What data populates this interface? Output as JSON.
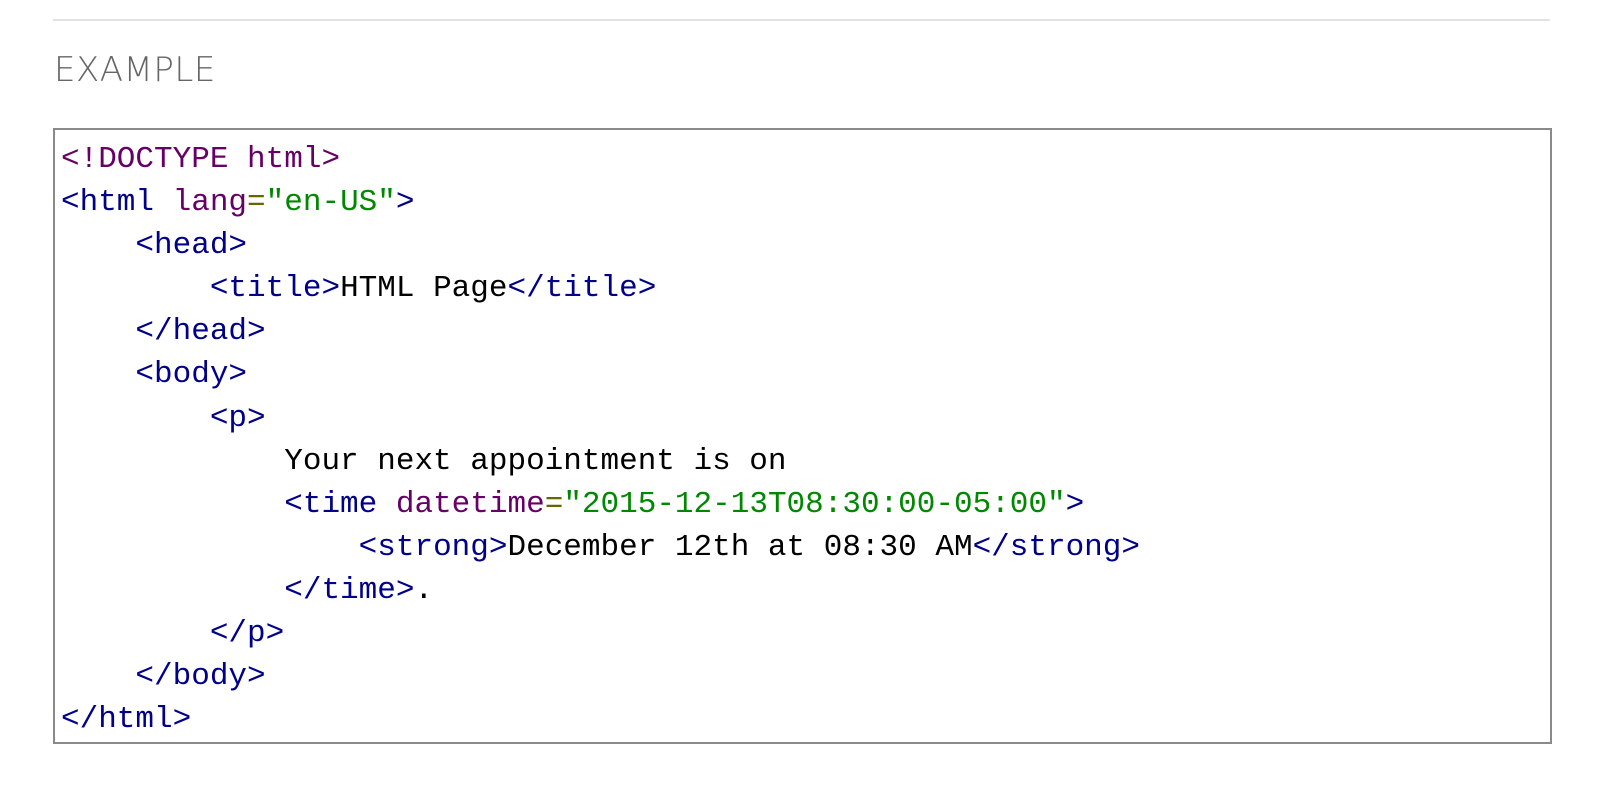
{
  "section": {
    "heading": "EXAMPLE"
  },
  "code": {
    "lines": [
      [
        [
          "dec",
          "<!DOCTYPE html>"
        ]
      ],
      [
        [
          "tag",
          "<html"
        ],
        [
          "pln",
          " "
        ],
        [
          "atn",
          "lang"
        ],
        [
          "pun",
          "="
        ],
        [
          "str",
          "\"en-US\""
        ],
        [
          "tag",
          ">"
        ]
      ],
      [
        [
          "pln",
          "    "
        ],
        [
          "tag",
          "<head>"
        ]
      ],
      [
        [
          "pln",
          "        "
        ],
        [
          "tag",
          "<title>"
        ],
        [
          "pln",
          "HTML Page"
        ],
        [
          "tag",
          "</title>"
        ]
      ],
      [
        [
          "pln",
          "    "
        ],
        [
          "tag",
          "</head>"
        ]
      ],
      [
        [
          "pln",
          "    "
        ],
        [
          "tag",
          "<body>"
        ]
      ],
      [
        [
          "pln",
          "        "
        ],
        [
          "tag",
          "<p>"
        ]
      ],
      [
        [
          "pln",
          "            Your next appointment is on"
        ]
      ],
      [
        [
          "pln",
          "            "
        ],
        [
          "tag",
          "<time"
        ],
        [
          "pln",
          " "
        ],
        [
          "atn",
          "datetime"
        ],
        [
          "pun",
          "="
        ],
        [
          "str",
          "\"2015-12-13T08:30:00-05:00\""
        ],
        [
          "tag",
          ">"
        ]
      ],
      [
        [
          "pln",
          "                "
        ],
        [
          "tag",
          "<strong>"
        ],
        [
          "pln",
          "December 12th at 08:30 AM"
        ],
        [
          "tag",
          "</strong>"
        ]
      ],
      [
        [
          "pln",
          "            "
        ],
        [
          "tag",
          "</time>"
        ],
        [
          "pln",
          "."
        ]
      ],
      [
        [
          "pln",
          "        "
        ],
        [
          "tag",
          "</p>"
        ]
      ],
      [
        [
          "pln",
          "    "
        ],
        [
          "tag",
          "</body>"
        ]
      ],
      [
        [
          "tag",
          "</html>"
        ]
      ]
    ]
  }
}
